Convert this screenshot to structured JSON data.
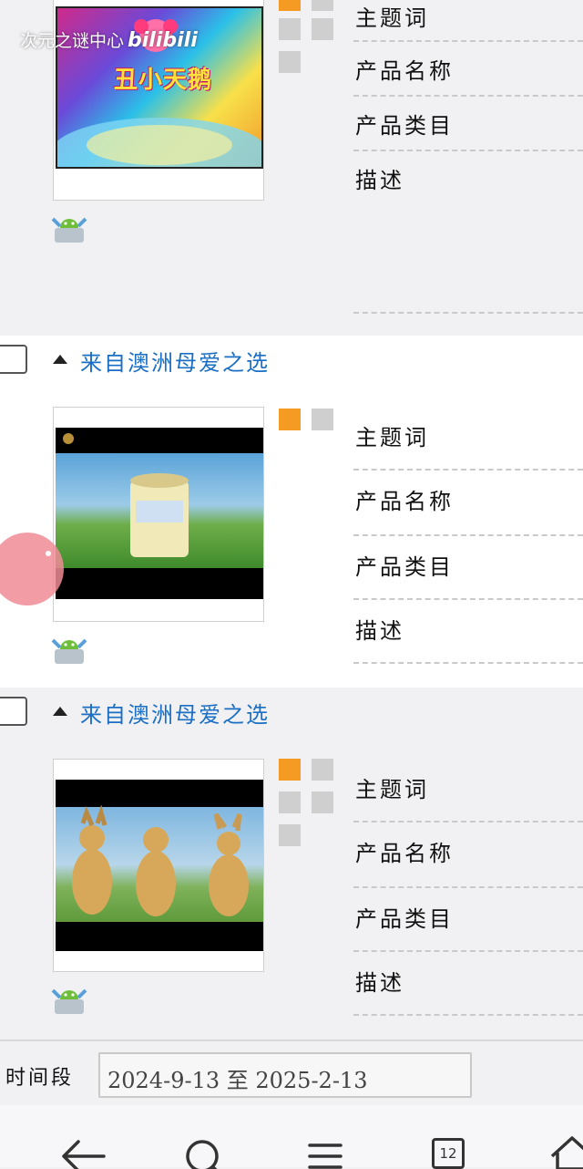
{
  "watermark": {
    "text": "次元之谜中心",
    "brand": "bilibili"
  },
  "products": [
    {
      "group_title": "",
      "fields": [
        "主题词",
        "产品名称",
        "产品类目",
        "描述"
      ]
    },
    {
      "group_title": "来自澳洲母爱之选",
      "fields": [
        "主题词",
        "产品名称",
        "产品类目",
        "描述"
      ]
    },
    {
      "group_title": "来自澳洲母爱之选",
      "fields": [
        "主题词",
        "产品名称",
        "产品类目",
        "描述"
      ]
    }
  ],
  "first_thumb_text": "丑小天鹅",
  "time_filter": {
    "label": "时间段",
    "value": "2024-9-13 至 2025-2-13"
  },
  "nav": {
    "tabs_count": "12",
    "icons": [
      "back-arrow-icon",
      "search-icon",
      "menu-icon",
      "tabs-icon",
      "home-icon"
    ]
  },
  "colors": {
    "accent_orange": "#f59a23",
    "link_blue": "#1a6fc4"
  }
}
